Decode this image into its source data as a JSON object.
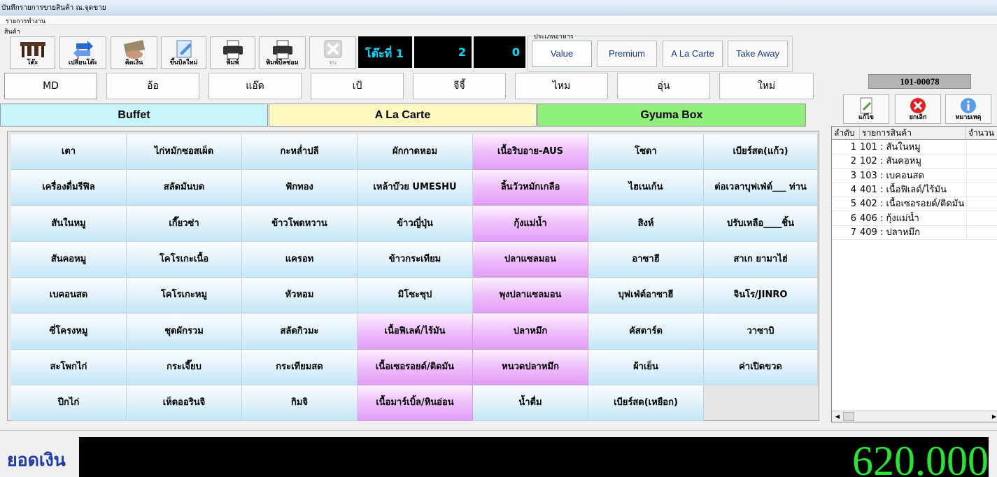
{
  "window": {
    "title": "บันทึกรายการขายสินค้า ณ.จุดขาย"
  },
  "menu": {
    "label": "รายการทำงาน"
  },
  "section_label": "สินค้า",
  "toolbar": [
    {
      "label": "โต๊ะ",
      "icon": "tables-icon"
    },
    {
      "label": "เปลี่ยนโต๊ะ",
      "icon": "swap-table-icon"
    },
    {
      "label": "คิดเงิน",
      "icon": "money-icon"
    },
    {
      "label": "ขึ้นบิลใหม่",
      "icon": "new-bill-icon"
    },
    {
      "label": "พิมพ์",
      "icon": "printer-icon"
    },
    {
      "label": "พิมพ์บิลซ่อม",
      "icon": "printer-icon"
    },
    {
      "label": "จบ",
      "icon": "close-icon"
    }
  ],
  "table_display": {
    "label": "โต๊ะที่ 1",
    "value_a": "2",
    "value_b": "0"
  },
  "food_type": {
    "legend": "ประเภทอาหาร",
    "options": [
      "Value",
      "Premium",
      "A La Carte",
      "Take Away"
    ],
    "selected": "Value"
  },
  "categories": [
    "MD",
    "อ้อ",
    "แอ๊ด",
    "เป้",
    "จีจี้",
    "ไหม",
    "อุ่น",
    "ใหม่"
  ],
  "selected_category": "MD",
  "bill_no": "101-00078",
  "tabs": [
    {
      "label": "Buffet",
      "color": "#c8f5fa"
    },
    {
      "label": "A La Carte",
      "color": "#fcf8c0"
    },
    {
      "label": "Gyuma Box",
      "color": "#8ef07a"
    }
  ],
  "side_buttons": [
    {
      "label": "แก้ไข",
      "icon": "edit-icon"
    },
    {
      "label": "ยกเลิก",
      "icon": "cancel-icon"
    },
    {
      "label": "หมายเหตุ",
      "icon": "info-icon"
    }
  ],
  "products": [
    [
      "เตา",
      "ไก่หมักซอสเผ็ด",
      "กะหล่ำปลี",
      "ผักกาดหอม",
      "เนื้อริบอาย-AUS",
      "โซดา",
      "เบียร์สด(แก้ว)"
    ],
    [
      "เครื่องดื่มรีฟิล",
      "สลัดมันบด",
      "ฟักทอง",
      "เหล้าบ๊วย UMESHU",
      "ลิ้นวัวหมักเกลือ",
      "ไฮเนเก้น",
      "ต่อเวลาบุฟเฟ่ต์___ ท่าน"
    ],
    [
      "สันในหมู",
      "เกี๊ยวซ่า",
      "ข้าวโพดหวาน",
      "ข้าวญี่ปุ่น",
      "กุ้งแม่น้ำ",
      "สิงห์",
      "ปรับเหลือ____ชิ้น"
    ],
    [
      "สันคอหมู",
      "โคโรเกะเนื้อ",
      "แครอท",
      "ข้าวกระเทียม",
      "ปลาแซลมอน",
      "อาซาฮี",
      "สาเก ยามาไฮ่"
    ],
    [
      "เบคอนสด",
      "โคโรเกะหมู",
      "หัวหอม",
      "มิโซะซุป",
      "พุงปลาแซลมอน",
      "บุฟเฟ่ต์อาซาฮี",
      "จินโร/JINRO"
    ],
    [
      "ซี่โครงหมู",
      "ชุดผักรวม",
      "สลัดกิวมะ",
      "เนื้อฟิเลต์/ไร้มัน",
      "ปลาหมึก",
      "คัสตาร์ด",
      "วาซาบิ"
    ],
    [
      "สะโพกไก่",
      "กระเจี๊ยบ",
      "กระเทียมสด",
      "เนื้อเซอรอยด์/ติดมัน",
      "หนวดปลาหมึก",
      "ผ้าเย็น",
      "ค่าเปิดขวด"
    ],
    [
      "ปีกไก่",
      "เห็ดออรินจิ",
      "กิมจิ",
      "เนื้อมาร์เบิ้ล/หินอ่อน",
      "น้ำดื่ม",
      "เบียร์สด(เหยือก)",
      ""
    ]
  ],
  "pink_cells": [
    [
      0,
      4
    ],
    [
      1,
      4
    ],
    [
      2,
      4
    ],
    [
      3,
      4
    ],
    [
      4,
      4
    ],
    [
      5,
      3
    ],
    [
      5,
      4
    ],
    [
      6,
      3
    ],
    [
      6,
      4
    ],
    [
      7,
      3
    ]
  ],
  "order_list": {
    "headers": [
      "ลำดับ",
      "รายการสินค้า",
      "จำนวน"
    ],
    "rows": [
      {
        "no": "1",
        "item": "101 : สันในหมู"
      },
      {
        "no": "2",
        "item": "102 : สันคอหมู"
      },
      {
        "no": "3",
        "item": "103 : เบคอนสด"
      },
      {
        "no": "4",
        "item": "401 : เนื้อฟิเลต์/ไร้มัน"
      },
      {
        "no": "5",
        "item": "402 : เนื้อเซอรอยด์/ติดมัน"
      },
      {
        "no": "6",
        "item": "406 : กุ้งแม่น้ำ"
      },
      {
        "no": "7",
        "item": "409 : ปลาหมึก"
      }
    ]
  },
  "total": {
    "label": "ยอดเงิน",
    "value": "620.000"
  }
}
